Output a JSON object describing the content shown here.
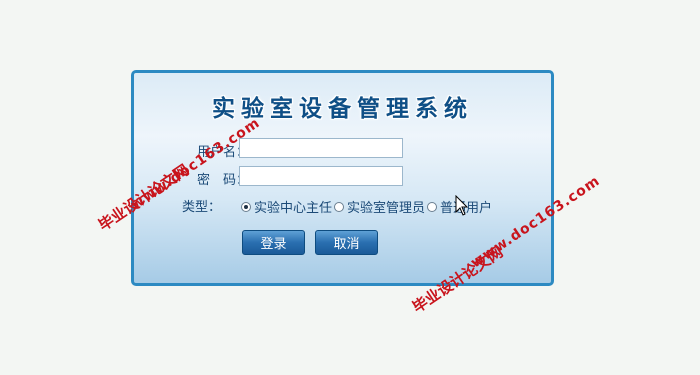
{
  "login": {
    "title": "实验室设备管理系统",
    "username_label": "用户名：",
    "password_label": "密　码：",
    "username_value": "",
    "password_value": "",
    "type_label": "类型：",
    "roles": [
      {
        "label": "实验中心主任",
        "checked": true
      },
      {
        "label": "实验室管理员",
        "checked": false
      },
      {
        "label": "普通用户",
        "checked": false
      }
    ],
    "login_button": "登录",
    "cancel_button": "取消"
  },
  "watermarks": {
    "left_cn": "毕业设计论文网",
    "left_url": "www.doc163.com",
    "right_cn": "毕业设计论文网",
    "right_url": "www.doc163.com"
  }
}
